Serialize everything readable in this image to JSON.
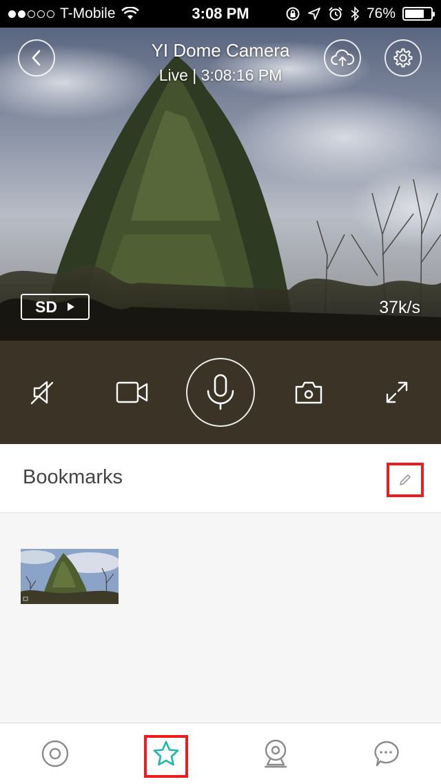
{
  "status_bar": {
    "carrier": "T-Mobile",
    "time": "3:08 PM",
    "battery": "76%",
    "battery_level": 0.76
  },
  "camera": {
    "title": "YI Dome Camera",
    "subtitle": "Live | 3:08:16 PM",
    "quality_label": "SD",
    "bitrate": "37k/s"
  },
  "controls": [
    {
      "name": "mute",
      "icon": "speaker-muted-icon"
    },
    {
      "name": "record",
      "icon": "video-camera-icon"
    },
    {
      "name": "talk",
      "icon": "microphone-icon"
    },
    {
      "name": "snapshot",
      "icon": "camera-icon"
    },
    {
      "name": "fullscreen",
      "icon": "expand-icon"
    }
  ],
  "bookmarks": {
    "title": "Bookmarks",
    "edit_icon": "pencil-icon"
  },
  "tabs": [
    {
      "name": "live",
      "icon": "camera-lens-icon"
    },
    {
      "name": "bookmarks",
      "icon": "star-icon",
      "active": true
    },
    {
      "name": "devices",
      "icon": "webcam-icon"
    },
    {
      "name": "messages",
      "icon": "chat-bubble-icon"
    }
  ],
  "colors": {
    "accent": "#1cb7a8",
    "highlight": "#ee1c1c",
    "controls_bg": "#3b3326"
  }
}
